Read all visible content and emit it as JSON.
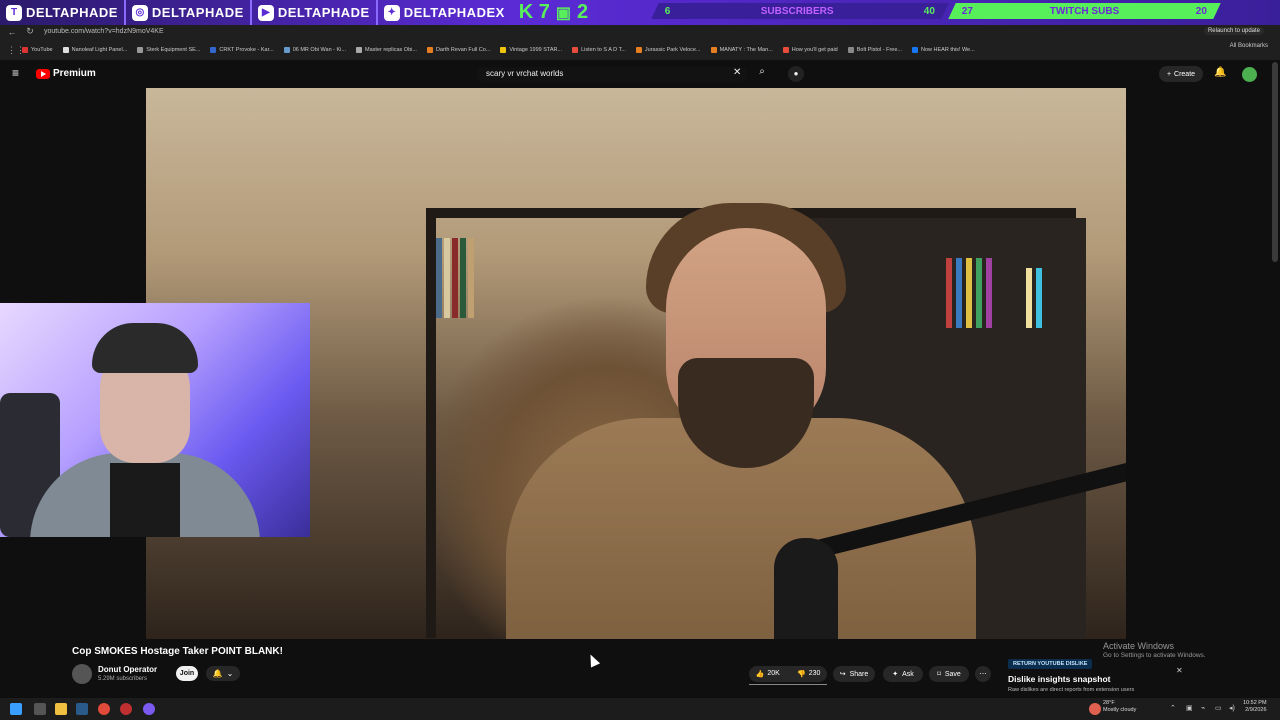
{
  "overlay": {
    "socials": [
      {
        "icon": "twitch-icon",
        "name": "DELTAPHADE"
      },
      {
        "icon": "instagram-icon",
        "name": "DELTAPHADE"
      },
      {
        "icon": "youtube-icon",
        "name": "DELTAPHADE"
      },
      {
        "icon": "twitter-icon",
        "name": "DELTAPHADEX"
      }
    ],
    "k7": "K 7",
    "k7_num": "2",
    "subscriber_goal": {
      "current": "6",
      "label": "SUBSCRIBERS",
      "target": "40"
    },
    "twitch_goal": {
      "current": "27",
      "label": "TWITCH SUBS",
      "target": "20"
    },
    "colors": {
      "accent": "#58f05a",
      "purple": "#5b2bd6"
    }
  },
  "browser": {
    "url": "youtube.com/watch?v=hdzN9moV4KE",
    "relaunch_label": "Relaunch to update",
    "bookmarks": [
      "YouTube",
      "Nanoleaf Light Panel...",
      "Sterk Equipment SE...",
      "CRKT Provoke - Kar...",
      "06 MR Obi Wan - Ki...",
      "Master replicas Obi...",
      "Darth Revan Full Co...",
      "Vintage 1999 STAR...",
      "Listen to S A D T...",
      "Jurassic Park Veloce...",
      "MANATY : The Man...",
      "How you'll get paid",
      "Bolt Pistol - Free...",
      "Now HEAR this! We..."
    ],
    "all_bookmarks": "All Bookmarks"
  },
  "youtube": {
    "logo_text": "Premium",
    "search_value": "scary vr vrchat worlds",
    "create_label": "Create",
    "video_title": "Cop SMOKES Hostage Taker POINT BLANK!",
    "channel_name": "Donut Operator",
    "channel_subs": "5.29M subscribers",
    "join_label": "Join",
    "likes": "20K",
    "dislikes": "230",
    "share_label": "Share",
    "ask_label": "Ask",
    "save_label": "Save"
  },
  "ryd": {
    "badge": "RETURN YOUTUBE DISLIKE",
    "title": "Dislike insights snapshot",
    "subtitle": "Raw dislikes are direct reports from extension users"
  },
  "windows": {
    "activate_title": "Activate Windows",
    "activate_sub": "Go to Settings to activate Windows.",
    "weather_temp": "28°F",
    "weather_desc": "Mostly cloudy",
    "time": "10:52 PM",
    "date": "2/9/2026"
  }
}
